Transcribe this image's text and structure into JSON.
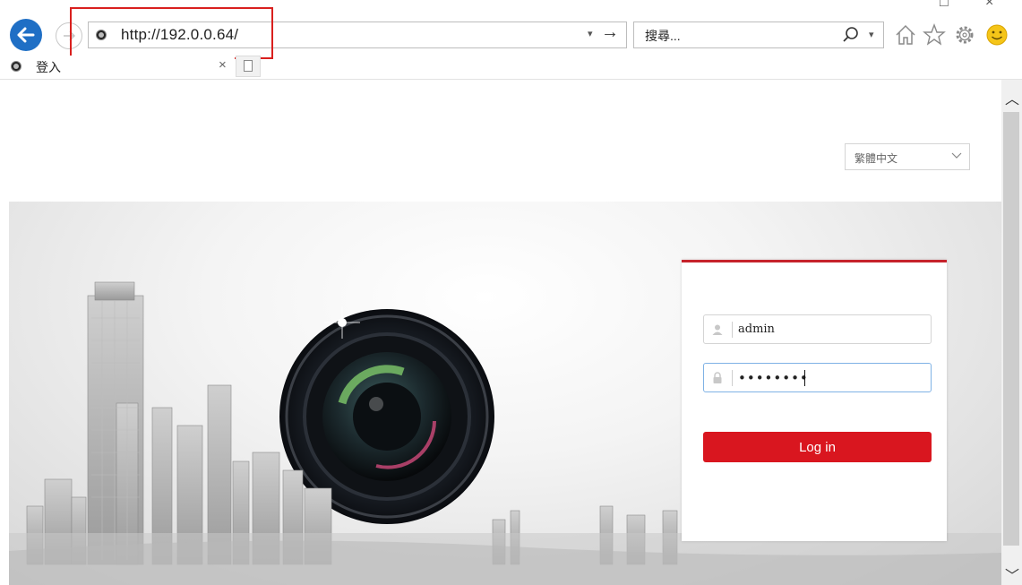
{
  "browser": {
    "address_url": "http://192.0.0.64/",
    "search_placeholder": "搜尋...",
    "tab_title": "登入",
    "tab_close": "×",
    "window_controls": [
      "□",
      "×"
    ],
    "toolbar_icons": [
      "home-icon",
      "favorites-star-icon",
      "settings-gear-icon",
      "feedback-smiley-icon"
    ]
  },
  "login": {
    "language": "繁體中文",
    "username": "admin",
    "password": "••••••••",
    "login_button": "Log in",
    "accent_color": "#d9161f"
  },
  "colors": {
    "back_button": "#1f6fc5",
    "highlight_box": "#d9201e"
  }
}
